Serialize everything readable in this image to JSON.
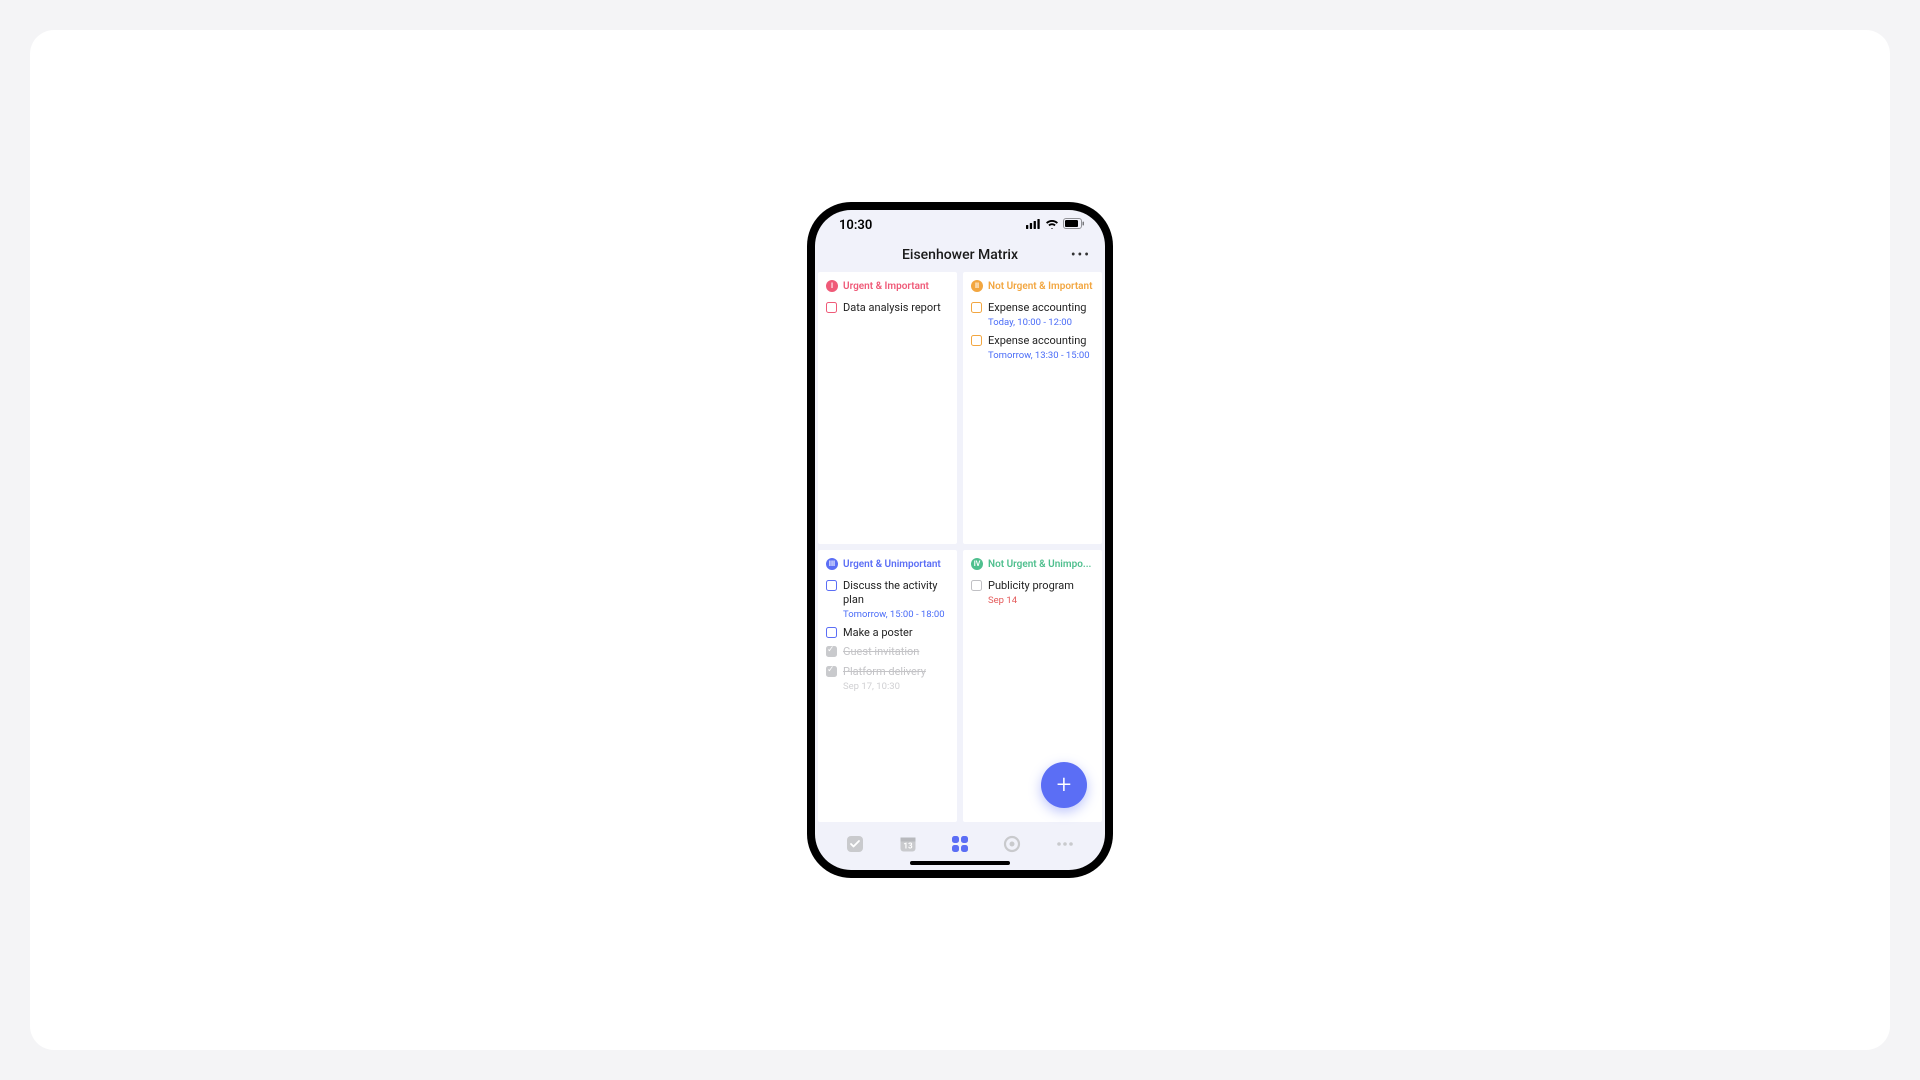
{
  "status": {
    "time": "10:30"
  },
  "header": {
    "title": "Eisenhower Matrix"
  },
  "colors": {
    "q1": "#ef5a78",
    "q2": "#f2a640",
    "q3": "#5b6ef5",
    "q4": "#4fbf8e"
  },
  "quadrants": [
    {
      "badge": "I",
      "label": "Urgent & Important",
      "color": "#ef5a78",
      "tasks": [
        {
          "title": "Data analysis report",
          "checkColor": "#ef5a78",
          "done": false
        }
      ]
    },
    {
      "badge": "II",
      "label": "Not Urgent & Important",
      "color": "#f2a640",
      "tasks": [
        {
          "title": "Expense accounting",
          "meta": "Today, 10:00 - 12:00",
          "metaClass": "meta-blue",
          "checkColor": "#f2a640",
          "done": false
        },
        {
          "title": "Expense accounting",
          "meta": "Tomorrow, 13:30 - 15:00",
          "metaClass": "meta-blue",
          "checkColor": "#f2a640",
          "done": false
        }
      ]
    },
    {
      "badge": "III",
      "label": "Urgent & Unimportant",
      "color": "#5b6ef5",
      "tasks": [
        {
          "title": "Discuss the activity plan",
          "meta": "Tomorrow, 15:00 - 18:00",
          "metaClass": "meta-blue",
          "checkColor": "#5b6ef5",
          "done": false
        },
        {
          "title": "Make a poster",
          "checkColor": "#5b6ef5",
          "done": false
        },
        {
          "title": "Guest invitation",
          "done": true
        },
        {
          "title": "Platform delivery",
          "meta": "Sep 17, 10:30",
          "metaClass": "meta-grey",
          "done": true
        }
      ]
    },
    {
      "badge": "IV",
      "label": "Not Urgent & Unimpo...",
      "color": "#4fbf8e",
      "tasks": [
        {
          "title": "Publicity program",
          "meta": "Sep 14",
          "metaClass": "meta-red",
          "checkColor": "#c0c0c4",
          "done": false
        }
      ]
    }
  ],
  "fab": {
    "label": "+"
  }
}
